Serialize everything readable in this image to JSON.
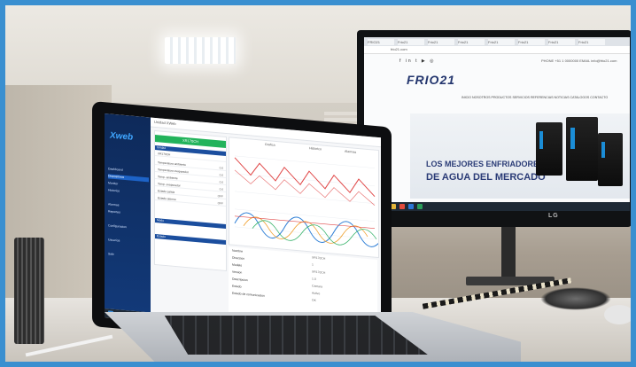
{
  "monitor": {
    "browser_tabs": [
      "FRIO21",
      "Frio21",
      "Frio21",
      "Frio21",
      "Frio21",
      "Frio21",
      "Frio21",
      "Frio21"
    ],
    "address": "frio21.com",
    "social_icons": [
      "facebook-icon",
      "linkedin-icon",
      "twitter-icon",
      "youtube-icon",
      "instagram-icon"
    ],
    "contact": "PHONE +51 1 0000000  EMAIL info@frio21.com",
    "logo_text": "FRIO21",
    "nav_items": "INICIO  NOSOTROS  PRODUCTOS  SERVICIOS  REFERENCIAS  NOTICIAS  CATALOGOS  CONTACTO",
    "hero_line_1": "LOS MEJORES ENFRIADORES",
    "hero_line_2": "DE AGUA DEL MERCADO",
    "brand": "LG"
  },
  "laptop": {
    "app_logo": "Xweb",
    "app_header_title": "Unidad XWeb",
    "sidebar_items": [
      "Dashboard",
      "Dispositivos",
      "Monitor",
      "Historico",
      "Alarmas",
      "Reportes",
      "Configuracion",
      "Usuarios",
      "Salir"
    ],
    "panel_tab": "Tiempo real",
    "green_tab": "XR170CH",
    "list_header_1": "Unidad",
    "list_rows": [
      {
        "label": "XR170CH",
        "value": ""
      },
      {
        "label": "Temperatura ambiente",
        "value": "0.0"
      },
      {
        "label": "Temperatura evaporador",
        "value": "0.0"
      },
      {
        "label": "Temp. ambiente",
        "value": "0.0"
      },
      {
        "label": "Temp. evaporador",
        "value": "0.0"
      },
      {
        "label": "Estado salida",
        "value": "OFF"
      },
      {
        "label": "Estado alarma",
        "value": "OFF"
      }
    ],
    "list_header_2": "Modo",
    "list_header_3": "Estado",
    "chart_tabs": [
      "Grafica",
      "Historico",
      "Alarmas"
    ],
    "detail_rows": [
      {
        "label": "Nombre",
        "value": "XR170CH"
      },
      {
        "label": "Direccion",
        "value": "1"
      },
      {
        "label": "Modelo",
        "value": "XR170CH"
      },
      {
        "label": "Version",
        "value": "1.0"
      },
      {
        "label": "Descripcion",
        "value": "Camara"
      },
      {
        "label": "Estado",
        "value": "Activo"
      },
      {
        "label": "Estado de comunicacion",
        "value": "OK"
      }
    ]
  },
  "colors": {
    "accent_blue": "#1b4e9e",
    "accent_green": "#22b35b",
    "sidebar_blue": "#0e2a5a",
    "frio_navy": "#2a3b76",
    "chart_red": "#e04848",
    "chart_blue": "#2f7fd6"
  }
}
